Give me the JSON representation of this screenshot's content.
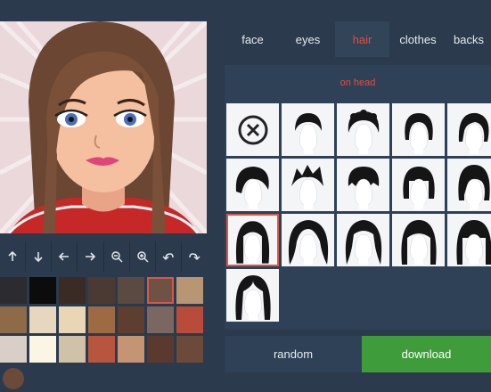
{
  "tabs": [
    {
      "label": "face"
    },
    {
      "label": "eyes"
    },
    {
      "label": "hair",
      "active": true
    },
    {
      "label": "clothes"
    },
    {
      "label": "backs"
    }
  ],
  "subtab": {
    "label": "on head"
  },
  "toolbar": {
    "buttons": [
      {
        "name": "move-up",
        "icon": "arrow-up-icon"
      },
      {
        "name": "move-down",
        "icon": "arrow-down-icon"
      },
      {
        "name": "move-left",
        "icon": "arrow-left-icon"
      },
      {
        "name": "move-right",
        "icon": "arrow-right-icon"
      },
      {
        "name": "zoom-out",
        "icon": "zoom-out-icon"
      },
      {
        "name": "zoom-in",
        "icon": "zoom-in-icon"
      },
      {
        "name": "undo",
        "icon": "undo-icon"
      },
      {
        "name": "redo",
        "icon": "redo-icon"
      }
    ]
  },
  "swatches": [
    "#2c2b30",
    "#0c0c0c",
    "#3a2c24",
    "#4a3a33",
    "#5a4a42",
    "#6e5243",
    "#b89673",
    "#8d6a48",
    "#e8d7bf",
    "#e8d6b6",
    "#9c6a43",
    "#5e3f2f",
    "#7b6761",
    "#b84b39",
    "#d8cfc8",
    "#fbf5e6",
    "#d0c2a8",
    "#b8553f",
    "#c49473",
    "#5a3a2e",
    "#6b4a3a"
  ],
  "selected_swatch": 5,
  "hair_styles": [
    "none",
    "short-cropped",
    "curly-short",
    "bob-short",
    "side-bob",
    "wavy-short",
    "spiky-messy",
    "tousled-fringe",
    "bob-fringe",
    "fringe-bob",
    "long-straight",
    "long-curly",
    "long-wavy",
    "long-layered",
    "long-blunt-fringe",
    "long-center-part"
  ],
  "selected_hair": 10,
  "buttons": {
    "random": "random",
    "download": "download"
  },
  "colors": {
    "accent": "#e74c3c",
    "panel": "#2f4157",
    "background": "#2b3a4c",
    "download": "#3f9c3a"
  }
}
